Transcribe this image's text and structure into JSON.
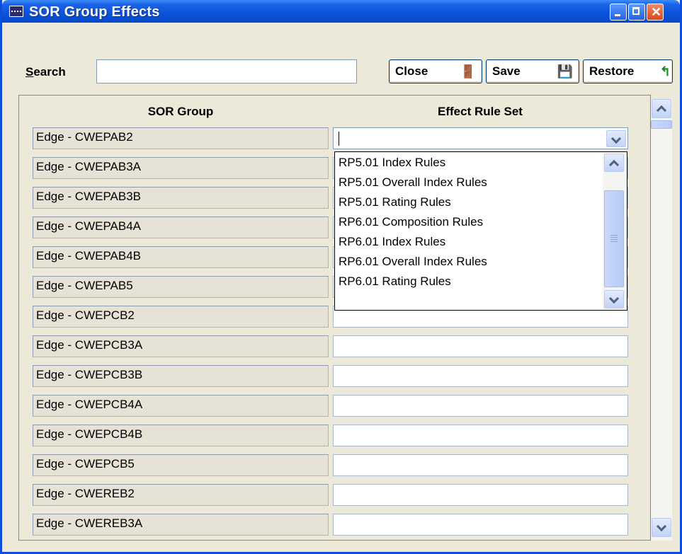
{
  "window": {
    "title": "SOR Group Effects"
  },
  "toolbar": {
    "search_label_accel": "S",
    "search_label_rest": "earch",
    "search_value": "",
    "close_label": "Close",
    "save_label": "Save",
    "restore_label": "Restore"
  },
  "grid": {
    "headers": {
      "group": "SOR Group",
      "rule_set": "Effect Rule Set"
    },
    "rows": [
      {
        "group": "Edge - CWEPAB2",
        "rule_set": ""
      },
      {
        "group": "Edge - CWEPAB3A",
        "rule_set": ""
      },
      {
        "group": "Edge - CWEPAB3B",
        "rule_set": ""
      },
      {
        "group": "Edge - CWEPAB4A",
        "rule_set": ""
      },
      {
        "group": "Edge - CWEPAB4B",
        "rule_set": ""
      },
      {
        "group": "Edge - CWEPAB5",
        "rule_set": ""
      },
      {
        "group": "Edge - CWEPCB2",
        "rule_set": ""
      },
      {
        "group": "Edge - CWEPCB3A",
        "rule_set": ""
      },
      {
        "group": "Edge - CWEPCB3B",
        "rule_set": ""
      },
      {
        "group": "Edge - CWEPCB4A",
        "rule_set": ""
      },
      {
        "group": "Edge - CWEPCB4B",
        "rule_set": ""
      },
      {
        "group": "Edge - CWEPCB5",
        "rule_set": ""
      },
      {
        "group": "Edge - CWEREB2",
        "rule_set": ""
      },
      {
        "group": "Edge - CWEREB3A",
        "rule_set": ""
      }
    ]
  },
  "dropdown": {
    "options": [
      "RP5.01 Index Rules",
      "RP5.01 Overall Index Rules",
      "RP5.01 Rating Rules",
      "RP6.01 Composition Rules",
      "RP6.01 Index Rules",
      "RP6.01 Overall Index Rules",
      "RP6.01 Rating Rules"
    ]
  },
  "icons": {
    "app": "grid-app-icon",
    "close": "door-exit-icon",
    "save": "save-disk-icon",
    "restore": "green-return-arrow-icon"
  },
  "colors": {
    "titlebar": "#0A52D8",
    "face": "#ECE9D8",
    "cell_gray": "#E6E2D6"
  }
}
